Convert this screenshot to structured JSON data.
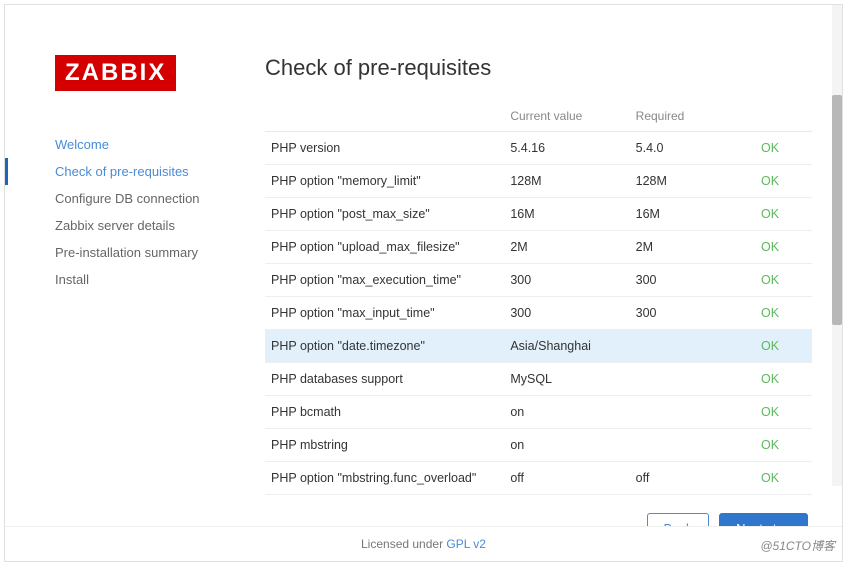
{
  "logo_text": "ZABBIX",
  "page_title": "Check of pre-requisites",
  "nav": [
    {
      "label": "Welcome",
      "state": "completed"
    },
    {
      "label": "Check of pre-requisites",
      "state": "active"
    },
    {
      "label": "Configure DB connection",
      "state": ""
    },
    {
      "label": "Zabbix server details",
      "state": ""
    },
    {
      "label": "Pre-installation summary",
      "state": ""
    },
    {
      "label": "Install",
      "state": ""
    }
  ],
  "table": {
    "headers": {
      "current": "Current value",
      "required": "Required"
    },
    "rows": [
      {
        "name": "PHP version",
        "current": "5.4.16",
        "required": "5.4.0",
        "status": "OK",
        "hl": false
      },
      {
        "name": "PHP option \"memory_limit\"",
        "current": "128M",
        "required": "128M",
        "status": "OK",
        "hl": false
      },
      {
        "name": "PHP option \"post_max_size\"",
        "current": "16M",
        "required": "16M",
        "status": "OK",
        "hl": false
      },
      {
        "name": "PHP option \"upload_max_filesize\"",
        "current": "2M",
        "required": "2M",
        "status": "OK",
        "hl": false
      },
      {
        "name": "PHP option \"max_execution_time\"",
        "current": "300",
        "required": "300",
        "status": "OK",
        "hl": false
      },
      {
        "name": "PHP option \"max_input_time\"",
        "current": "300",
        "required": "300",
        "status": "OK",
        "hl": false
      },
      {
        "name": "PHP option \"date.timezone\"",
        "current": "Asia/Shanghai",
        "required": "",
        "status": "OK",
        "hl": true
      },
      {
        "name": "PHP databases support",
        "current": "MySQL",
        "required": "",
        "status": "OK",
        "hl": false
      },
      {
        "name": "PHP bcmath",
        "current": "on",
        "required": "",
        "status": "OK",
        "hl": false
      },
      {
        "name": "PHP mbstring",
        "current": "on",
        "required": "",
        "status": "OK",
        "hl": false
      },
      {
        "name": "PHP option \"mbstring.func_overload\"",
        "current": "off",
        "required": "off",
        "status": "OK",
        "hl": false
      }
    ]
  },
  "buttons": {
    "back": "Back",
    "next": "Next step"
  },
  "footer": {
    "prefix": "Licensed under ",
    "link": "GPL v2"
  },
  "watermark": "@51CTO博客"
}
